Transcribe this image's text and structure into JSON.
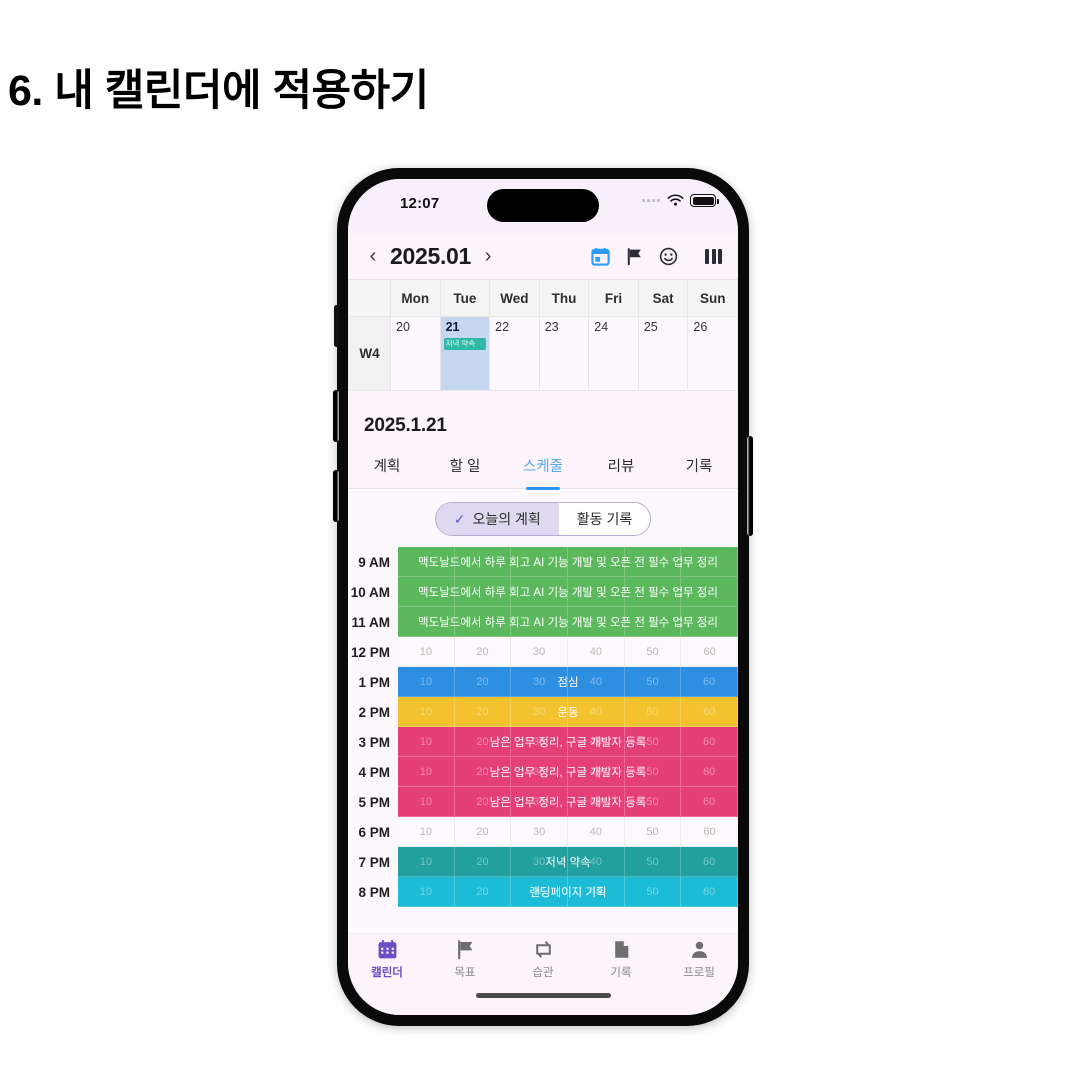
{
  "slide": {
    "title": "6. 내 캘린더에 적용하기"
  },
  "status_bar": {
    "time": "12:07",
    "wifi_icon": "wifi-icon",
    "battery_icon": "battery-icon",
    "signal_icon": "signal-dots-icon"
  },
  "app_header": {
    "prev_label": "‹",
    "next_label": "›",
    "month": "2025.01",
    "icons": [
      "calendar-icon",
      "flag-icon",
      "smiley-icon",
      "columns-icon"
    ]
  },
  "calendar": {
    "week_label": "W4",
    "weekday_headers": [
      "Mon",
      "Tue",
      "Wed",
      "Thu",
      "Fri",
      "Sat",
      "Sun"
    ],
    "days": [
      {
        "num": "20",
        "selected": false,
        "event": null
      },
      {
        "num": "21",
        "selected": true,
        "event": "저녁 약속"
      },
      {
        "num": "22",
        "selected": false,
        "event": null
      },
      {
        "num": "23",
        "selected": false,
        "event": null
      },
      {
        "num": "24",
        "selected": false,
        "event": null
      },
      {
        "num": "25",
        "selected": false,
        "event": null
      },
      {
        "num": "26",
        "selected": false,
        "event": null
      }
    ],
    "event_chip_color": "#2fb8a6",
    "selected_bg": "#c5d7f0"
  },
  "detail": {
    "date_title": "2025.1.21",
    "tabs": [
      {
        "label": "계획",
        "active": false
      },
      {
        "label": "할 일",
        "active": false
      },
      {
        "label": "스케줄",
        "active": true
      },
      {
        "label": "리뷰",
        "active": false
      },
      {
        "label": "기록",
        "active": false
      }
    ],
    "active_tab_color": "#2b96ef",
    "segmented": {
      "check_glyph": "✓",
      "options": [
        {
          "label": "오늘의 계획",
          "active": true
        },
        {
          "label": "활동 기록",
          "active": false
        }
      ],
      "active_bg": "#ded9f0"
    }
  },
  "timeline": {
    "minute_columns": [
      "10",
      "20",
      "30",
      "40",
      "50",
      "60"
    ],
    "rows": [
      {
        "time": "9 AM",
        "event": "맥도날드에서 하루 회고 AI 기능 개발 및 오픈 전 필수 업무 정리",
        "color": "#5cb85c",
        "show_minutes": false
      },
      {
        "time": "10 AM",
        "event": "맥도날드에서 하루 회고 AI 기능 개발 및 오픈 전 필수 업무 정리",
        "color": "#5cb85c",
        "show_minutes": false
      },
      {
        "time": "11 AM",
        "event": "맥도날드에서 하루 회고 AI 기능 개발 및 오픈 전 필수 업무 정리",
        "color": "#5cb85c",
        "show_minutes": false
      },
      {
        "time": "12 PM",
        "event": null,
        "color": null,
        "show_minutes": true
      },
      {
        "time": "1 PM",
        "event": "점심",
        "color": "#2e8fe0",
        "show_minutes": true
      },
      {
        "time": "2 PM",
        "event": "운동",
        "color": "#f3c22e",
        "show_minutes": true
      },
      {
        "time": "3 PM",
        "event": "남은 업무 정리, 구글 개발자 등록",
        "color": "#e53f78",
        "show_minutes": true
      },
      {
        "time": "4 PM",
        "event": "남은 업무 정리, 구글 개발자 등록",
        "color": "#e53f78",
        "show_minutes": true
      },
      {
        "time": "5 PM",
        "event": "남은 업무 정리, 구글 개발자 등록",
        "color": "#e53f78",
        "show_minutes": true
      },
      {
        "time": "6 PM",
        "event": null,
        "color": null,
        "show_minutes": true
      },
      {
        "time": "7 PM",
        "event": "저녁 약속",
        "color": "#22a0a0",
        "show_minutes": true
      },
      {
        "time": "8 PM",
        "event": "랜딩페이지 기획",
        "color": "#1dbcd6",
        "show_minutes": true
      }
    ]
  },
  "bottom_nav": {
    "items": [
      {
        "label": "캘린더",
        "icon": "calendar-icon",
        "active": true
      },
      {
        "label": "목표",
        "icon": "flag-icon",
        "active": false
      },
      {
        "label": "습관",
        "icon": "repeat-icon",
        "active": false
      },
      {
        "label": "기록",
        "icon": "document-icon",
        "active": false
      },
      {
        "label": "프로필",
        "icon": "person-icon",
        "active": false
      }
    ],
    "active_color": "#6b4fc4"
  }
}
